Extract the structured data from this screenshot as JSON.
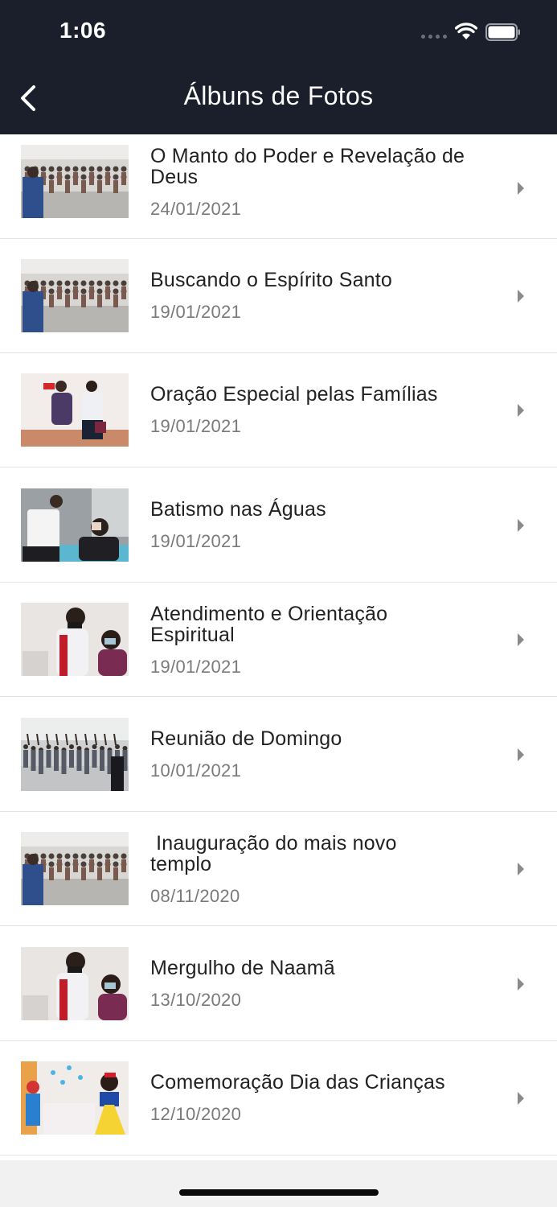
{
  "status": {
    "time": "1:06"
  },
  "header": {
    "title": "Álbuns de Fotos"
  },
  "albums": [
    {
      "title": "O Manto do Poder e Revelação de\nDeus",
      "date": "24/01/2021",
      "thumb": "hall-crowd"
    },
    {
      "title": "Buscando o Espírito Santo",
      "date": "19/01/2021",
      "thumb": "hall-crowd"
    },
    {
      "title": "Oração Especial pelas Famílias",
      "date": "19/01/2021",
      "thumb": "prayer"
    },
    {
      "title": "Batismo nas Águas",
      "date": "19/01/2021",
      "thumb": "baptism"
    },
    {
      "title": "Atendimento e Orientação\nEspiritual",
      "date": "19/01/2021",
      "thumb": "counsel"
    },
    {
      "title": "Reunião de Domingo",
      "date": "10/01/2021",
      "thumb": "worship"
    },
    {
      "title": " Inauguração do mais novo\ntemplo",
      "date": "08/11/2020",
      "thumb": "hall-crowd"
    },
    {
      "title": "Mergulho de Naamã",
      "date": "13/10/2020",
      "thumb": "counsel"
    },
    {
      "title": "Comemoração Dia das Crianças",
      "date": "12/10/2020",
      "thumb": "kids"
    }
  ],
  "colors": {
    "header_bg": "#1b1f2b",
    "date": "#7a7a7a",
    "divider": "#e3e3e3"
  }
}
